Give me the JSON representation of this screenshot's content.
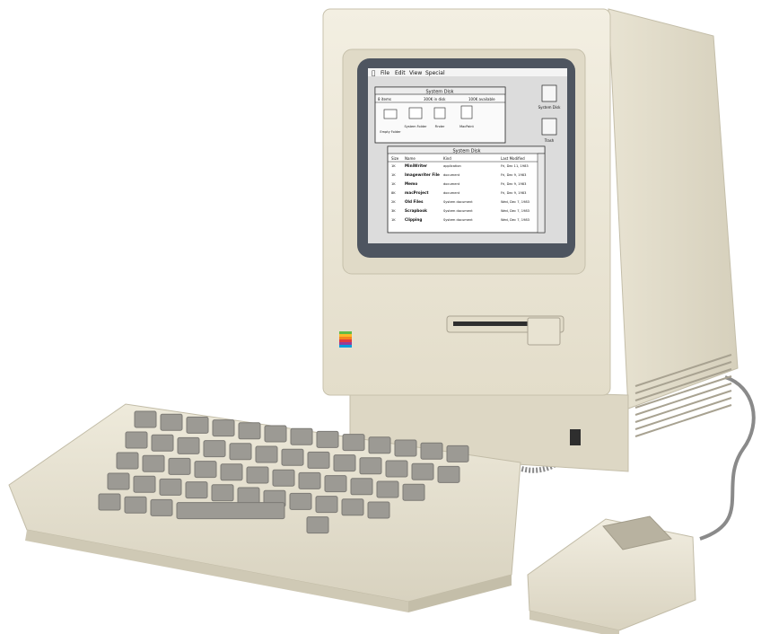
{
  "screen": {
    "menubar": [
      "File",
      "Edit",
      "View",
      "Special"
    ],
    "back_window": {
      "title": "System Disk",
      "info_left": "8 items",
      "info_mid": "300K in disk",
      "info_right": "100K available",
      "icons": [
        "Empty Folder",
        "System Folder",
        "Finder",
        "MacPaint"
      ]
    },
    "front_window": {
      "title": "System Disk",
      "headers": [
        "Size",
        "Name",
        "Kind",
        "Last Modified"
      ],
      "rows": [
        {
          "size": "1K",
          "name": "MiniWriter",
          "kind": "application",
          "date": "Fri, Dec 11, 1983"
        },
        {
          "size": "1K",
          "name": "Imagewriter File",
          "kind": "document",
          "date": "Fri, Dec 9, 1983"
        },
        {
          "size": "1K",
          "name": "Memo",
          "kind": "document",
          "date": "Fri, Dec 9, 1983"
        },
        {
          "size": "8K",
          "name": "macProject",
          "kind": "document",
          "date": "Fri, Dec 9, 1983"
        },
        {
          "size": "2K",
          "name": "Old Files",
          "kind": "System document",
          "date": "Wed, Dec 7, 1983"
        },
        {
          "size": "3K",
          "name": "Scrapbook",
          "kind": "System document",
          "date": "Wed, Dec 7, 1983"
        },
        {
          "size": "1K",
          "name": "Clipping",
          "kind": "System document",
          "date": "Wed, Dec 7, 1983"
        }
      ]
    },
    "desktop_icons": [
      "System Disk",
      "Trash"
    ]
  },
  "colors": {
    "case": "#ebe6d6",
    "case_shadow": "#cfc9b6",
    "screen_bezel": "#4e5560",
    "screen": "#dcdcdc",
    "key": "#9c9a94",
    "cable": "#8a8a8a"
  }
}
